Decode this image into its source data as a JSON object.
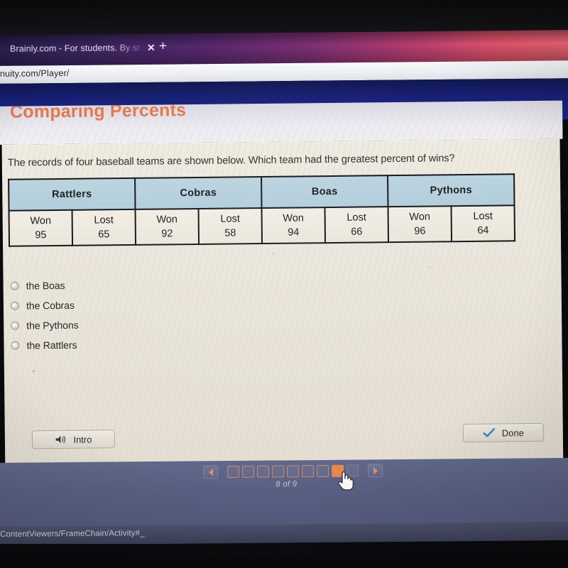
{
  "browser": {
    "tab_title": "Brainly.com - For students. By st",
    "tab_close_icon": "close-icon",
    "new_tab_icon": "plus-icon",
    "url": "nuity.com/Player/"
  },
  "lesson": {
    "title": "Comparing Percents",
    "question": "The records of four baseball teams are shown below. Which team had the greatest percent of wins?"
  },
  "table": {
    "teams": [
      "Rattlers",
      "Cobras",
      "Boas",
      "Pythons"
    ],
    "sub_headers": [
      "Won",
      "Lost"
    ],
    "records": [
      {
        "team": "Rattlers",
        "won": "95",
        "lost": "65"
      },
      {
        "team": "Cobras",
        "won": "92",
        "lost": "58"
      },
      {
        "team": "Boas",
        "won": "94",
        "lost": "66"
      },
      {
        "team": "Pythons",
        "won": "96",
        "lost": "64"
      }
    ]
  },
  "choices": [
    {
      "label": "the Boas",
      "selected": false
    },
    {
      "label": "the Cobras",
      "selected": false
    },
    {
      "label": "the Pythons",
      "selected": false
    },
    {
      "label": "the Rattlers",
      "selected": false
    }
  ],
  "buttons": {
    "intro_label": "Intro",
    "intro_icon": "speaker-icon",
    "done_label": "Done",
    "done_icon": "check-icon"
  },
  "pagination": {
    "prev_icon": "triangle-left-icon",
    "next_icon": "triangle-right-icon",
    "total_pages": 9,
    "current_page": 8,
    "count_text": "8 of 9",
    "cursor_icon": "hand-pointer-cursor"
  },
  "statusbar": {
    "text": "ContentViewers/FrameChain/Activity#_"
  },
  "colors": {
    "title_orange": "#e2794e",
    "table_header_blue": "#b3cfdd",
    "pager_current": "#e8894f",
    "blue_band": "#1b2684",
    "sheet_cream": "#eae5da"
  }
}
